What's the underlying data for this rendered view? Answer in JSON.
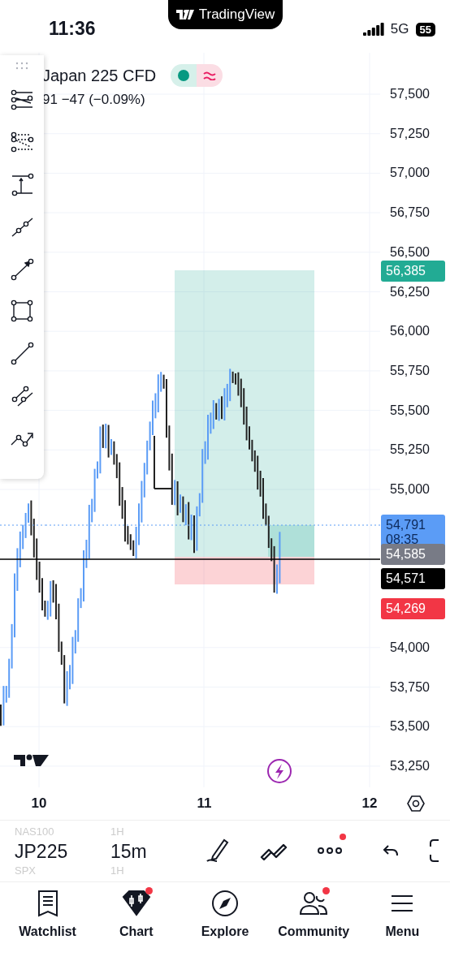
{
  "status_bar": {
    "time": "11:36",
    "network": "5G",
    "battery": "55"
  },
  "island": {
    "brand": "TradingView"
  },
  "symbol": {
    "name": "Japan 225 CFD",
    "change": "91  −47 (−0.09%)"
  },
  "price_axis": {
    "ticks": [
      "57,500",
      "57,250",
      "57,000",
      "56,750",
      "56,500",
      "56,250",
      "56,000",
      "55,750",
      "55,500",
      "55,250",
      "55,000",
      "54,000",
      "53,750",
      "53,500",
      "53,250"
    ],
    "labels": [
      {
        "kind": "target",
        "lines": [
          "56,385"
        ]
      },
      {
        "kind": "last",
        "lines": [
          "54,791",
          "08:35"
        ]
      },
      {
        "kind": "entry",
        "lines": [
          "54,585"
        ]
      },
      {
        "kind": "line",
        "lines": [
          "54,571"
        ]
      },
      {
        "kind": "stop",
        "lines": [
          "54,269"
        ]
      }
    ]
  },
  "time_axis": {
    "ticks": [
      "10",
      "11",
      "12"
    ]
  },
  "symbol_picker": [
    {
      "symbol": "NAS100",
      "interval": "1H",
      "selected": false
    },
    {
      "symbol": "JP225",
      "interval": "15m",
      "selected": true
    },
    {
      "symbol": "SPX",
      "interval": "1H",
      "selected": false
    }
  ],
  "toolbar": {
    "more_badge": true
  },
  "nav": [
    {
      "label": "Watchlist",
      "selected": false,
      "badge": false
    },
    {
      "label": "Chart",
      "selected": true,
      "badge": true
    },
    {
      "label": "Explore",
      "selected": false,
      "badge": false
    },
    {
      "label": "Community",
      "selected": false,
      "badge": true
    },
    {
      "label": "Menu",
      "selected": false,
      "badge": false
    }
  ]
}
